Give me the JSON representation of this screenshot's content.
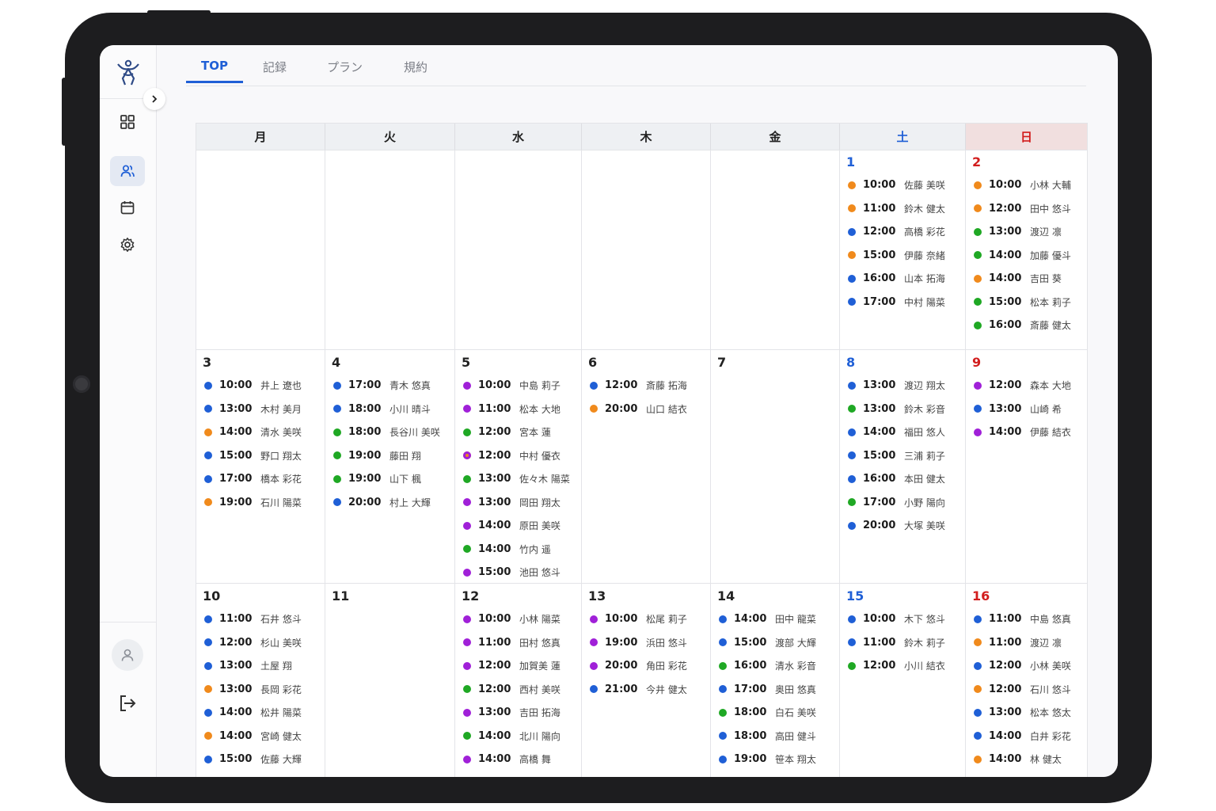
{
  "nav": {
    "tabs": [
      "TOP",
      "記録",
      "プラン",
      "規約"
    ],
    "active_tab": 0
  },
  "sidebar": {
    "items": [
      "dashboard-icon",
      "users-icon",
      "calendar-icon",
      "settings-icon"
    ],
    "active_item": 1
  },
  "calendar": {
    "weekdays": [
      "月",
      "火",
      "水",
      "木",
      "金",
      "土",
      "日"
    ],
    "weeks": [
      [
        null,
        null,
        null,
        null,
        null,
        {
          "day": "1",
          "appts": [
            {
              "t": "10:00",
              "n": "佐藤 美咲",
              "c": "orange"
            },
            {
              "t": "11:00",
              "n": "鈴木 健太",
              "c": "orange"
            },
            {
              "t": "12:00",
              "n": "高橋 彩花",
              "c": "blue"
            },
            {
              "t": "15:00",
              "n": "伊藤 奈緒",
              "c": "orange"
            },
            {
              "t": "16:00",
              "n": "山本 拓海",
              "c": "blue"
            },
            {
              "t": "17:00",
              "n": "中村 陽菜",
              "c": "blue"
            }
          ]
        },
        {
          "day": "2",
          "appts": [
            {
              "t": "10:00",
              "n": "小林 大輔",
              "c": "orange"
            },
            {
              "t": "12:00",
              "n": "田中 悠斗",
              "c": "orange"
            },
            {
              "t": "13:00",
              "n": "渡辺 凛",
              "c": "green"
            },
            {
              "t": "14:00",
              "n": "加藤 優斗",
              "c": "green"
            },
            {
              "t": "14:00",
              "n": "吉田 葵",
              "c": "orange"
            },
            {
              "t": "15:00",
              "n": "松本 莉子",
              "c": "green"
            },
            {
              "t": "16:00",
              "n": "斎藤 健太",
              "c": "green"
            }
          ]
        }
      ],
      [
        {
          "day": "3",
          "appts": [
            {
              "t": "10:00",
              "n": "井上 遼也",
              "c": "blue"
            },
            {
              "t": "13:00",
              "n": "木村 美月",
              "c": "blue"
            },
            {
              "t": "14:00",
              "n": "清水 美咲",
              "c": "orange"
            },
            {
              "t": "15:00",
              "n": "野口 翔太",
              "c": "blue"
            },
            {
              "t": "17:00",
              "n": "橋本 彩花",
              "c": "blue"
            },
            {
              "t": "19:00",
              "n": "石川 陽菜",
              "c": "orange"
            }
          ]
        },
        {
          "day": "4",
          "appts": [
            {
              "t": "17:00",
              "n": "青木 悠真",
              "c": "blue"
            },
            {
              "t": "18:00",
              "n": "小川 晴斗",
              "c": "blue"
            },
            {
              "t": "18:00",
              "n": "長谷川 美咲",
              "c": "green"
            },
            {
              "t": "19:00",
              "n": "藤田 翔",
              "c": "green"
            },
            {
              "t": "19:00",
              "n": "山下 楓",
              "c": "green"
            },
            {
              "t": "20:00",
              "n": "村上 大輝",
              "c": "blue"
            }
          ]
        },
        {
          "day": "5",
          "appts": [
            {
              "t": "10:00",
              "n": "中島 莉子",
              "c": "purple"
            },
            {
              "t": "11:00",
              "n": "松本 大地",
              "c": "purple"
            },
            {
              "t": "12:00",
              "n": "宮本 蓮",
              "c": "green"
            },
            {
              "t": "12:00",
              "n": "中村 優衣",
              "c": "mixed"
            },
            {
              "t": "13:00",
              "n": "佐々木 陽菜",
              "c": "green"
            },
            {
              "t": "13:00",
              "n": "岡田 翔太",
              "c": "purple"
            },
            {
              "t": "14:00",
              "n": "原田 美咲",
              "c": "purple"
            },
            {
              "t": "14:00",
              "n": "竹内 遥",
              "c": "green"
            },
            {
              "t": "15:00",
              "n": "池田 悠斗",
              "c": "purple"
            }
          ]
        },
        {
          "day": "6",
          "appts": [
            {
              "t": "12:00",
              "n": "斎藤 拓海",
              "c": "blue"
            },
            {
              "t": "20:00",
              "n": "山口 結衣",
              "c": "orange"
            }
          ]
        },
        {
          "day": "7",
          "appts": []
        },
        {
          "day": "8",
          "appts": [
            {
              "t": "13:00",
              "n": "渡辺 翔太",
              "c": "blue"
            },
            {
              "t": "13:00",
              "n": "鈴木 彩音",
              "c": "green"
            },
            {
              "t": "14:00",
              "n": "福田 悠人",
              "c": "blue"
            },
            {
              "t": "15:00",
              "n": "三浦 莉子",
              "c": "blue"
            },
            {
              "t": "16:00",
              "n": "本田 健太",
              "c": "blue"
            },
            {
              "t": "17:00",
              "n": "小野 陽向",
              "c": "green"
            },
            {
              "t": "20:00",
              "n": "大塚 美咲",
              "c": "blue"
            }
          ]
        },
        {
          "day": "9",
          "appts": [
            {
              "t": "12:00",
              "n": "森本 大地",
              "c": "purple"
            },
            {
              "t": "13:00",
              "n": "山崎 希",
              "c": "blue"
            },
            {
              "t": "14:00",
              "n": "伊藤 結衣",
              "c": "purple"
            }
          ]
        }
      ],
      [
        {
          "day": "10",
          "appts": [
            {
              "t": "11:00",
              "n": "石井 悠斗",
              "c": "blue"
            },
            {
              "t": "12:00",
              "n": "杉山 美咲",
              "c": "blue"
            },
            {
              "t": "13:00",
              "n": "土屋 翔",
              "c": "blue"
            },
            {
              "t": "13:00",
              "n": "長岡 彩花",
              "c": "orange"
            },
            {
              "t": "14:00",
              "n": "松井 陽菜",
              "c": "blue"
            },
            {
              "t": "14:00",
              "n": "宮崎 健太",
              "c": "orange"
            },
            {
              "t": "15:00",
              "n": "佐藤 大輝",
              "c": "blue"
            }
          ]
        },
        {
          "day": "11",
          "appts": []
        },
        {
          "day": "12",
          "appts": [
            {
              "t": "10:00",
              "n": "小林 陽菜",
              "c": "purple"
            },
            {
              "t": "11:00",
              "n": "田村 悠真",
              "c": "purple"
            },
            {
              "t": "12:00",
              "n": "加賀美 蓮",
              "c": "purple"
            },
            {
              "t": "12:00",
              "n": "西村 美咲",
              "c": "green"
            },
            {
              "t": "13:00",
              "n": "吉田 拓海",
              "c": "purple"
            },
            {
              "t": "14:00",
              "n": "北川 陽向",
              "c": "green"
            },
            {
              "t": "14:00",
              "n": "高橋 舞",
              "c": "purple"
            }
          ]
        },
        {
          "day": "13",
          "appts": [
            {
              "t": "10:00",
              "n": "松尾 莉子",
              "c": "purple"
            },
            {
              "t": "19:00",
              "n": "浜田 悠斗",
              "c": "purple"
            },
            {
              "t": "20:00",
              "n": "角田 彩花",
              "c": "purple"
            },
            {
              "t": "21:00",
              "n": "今井 健太",
              "c": "blue"
            }
          ]
        },
        {
          "day": "14",
          "appts": [
            {
              "t": "14:00",
              "n": "田中 龍菜",
              "c": "blue"
            },
            {
              "t": "15:00",
              "n": "渡部 大輝",
              "c": "blue"
            },
            {
              "t": "16:00",
              "n": "清水 彩音",
              "c": "green"
            },
            {
              "t": "17:00",
              "n": "奥田 悠真",
              "c": "blue"
            },
            {
              "t": "18:00",
              "n": "白石 美咲",
              "c": "green"
            },
            {
              "t": "18:00",
              "n": "高田 健斗",
              "c": "blue"
            },
            {
              "t": "19:00",
              "n": "笹本 翔太",
              "c": "blue"
            }
          ]
        },
        {
          "day": "15",
          "appts": [
            {
              "t": "10:00",
              "n": "木下 悠斗",
              "c": "blue"
            },
            {
              "t": "11:00",
              "n": "鈴木 莉子",
              "c": "blue"
            },
            {
              "t": "12:00",
              "n": "小川 結衣",
              "c": "green"
            }
          ]
        },
        {
          "day": "16",
          "appts": [
            {
              "t": "11:00",
              "n": "中島 悠真",
              "c": "blue"
            },
            {
              "t": "11:00",
              "n": "渡辺 凛",
              "c": "orange"
            },
            {
              "t": "12:00",
              "n": "小林 美咲",
              "c": "blue"
            },
            {
              "t": "12:00",
              "n": "石川 悠斗",
              "c": "orange"
            },
            {
              "t": "13:00",
              "n": "松本 悠太",
              "c": "blue"
            },
            {
              "t": "14:00",
              "n": "白井 彩花",
              "c": "blue"
            },
            {
              "t": "14:00",
              "n": "林 健太",
              "c": "orange"
            }
          ]
        }
      ]
    ]
  },
  "colors": {
    "accent": "#1f5fd6",
    "saturday": "#1f5fd6",
    "sunday": "#d21d1d",
    "dot_blue": "#1f5fd6",
    "dot_orange": "#f08a1c",
    "dot_green": "#1fa824",
    "dot_purple": "#a020d8"
  }
}
